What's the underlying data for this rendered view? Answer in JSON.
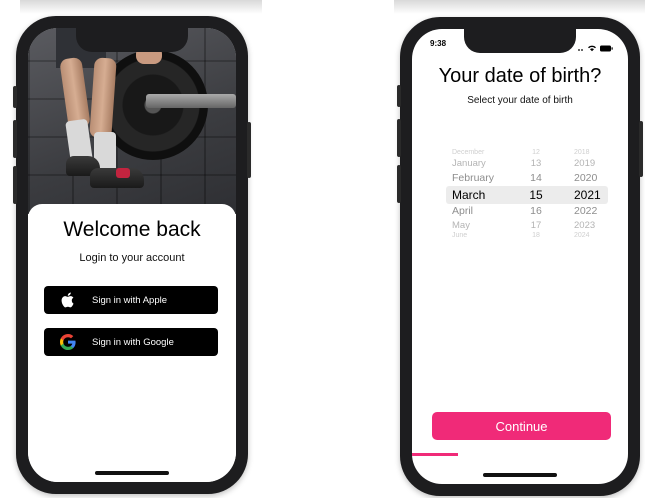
{
  "login": {
    "title": "Welcome back",
    "subtitle": "Login to your account",
    "apple_label": "Sign in with Apple",
    "google_label": "Sign in with Google"
  },
  "dob": {
    "status_time": "9:38",
    "title": "Your date of birth?",
    "subtitle": "Select your date of birth",
    "picker_rows": [
      {
        "month": "December",
        "day": "12",
        "year": "2018"
      },
      {
        "month": "January",
        "day": "13",
        "year": "2019"
      },
      {
        "month": "February",
        "day": "14",
        "year": "2020"
      },
      {
        "month": "March",
        "day": "15",
        "year": "2021",
        "selected": true
      },
      {
        "month": "April",
        "day": "16",
        "year": "2022"
      },
      {
        "month": "May",
        "day": "17",
        "year": "2023"
      },
      {
        "month": "June",
        "day": "18",
        "year": "2024"
      }
    ],
    "continue_label": "Continue"
  },
  "colors": {
    "accent_pink": "#f02a78",
    "phone_frame": "#1d1d1f",
    "button_black": "#000000"
  },
  "icons": [
    "apple-icon",
    "google-icon",
    "wifi-icon",
    "battery-icon",
    "signal-icon"
  ]
}
